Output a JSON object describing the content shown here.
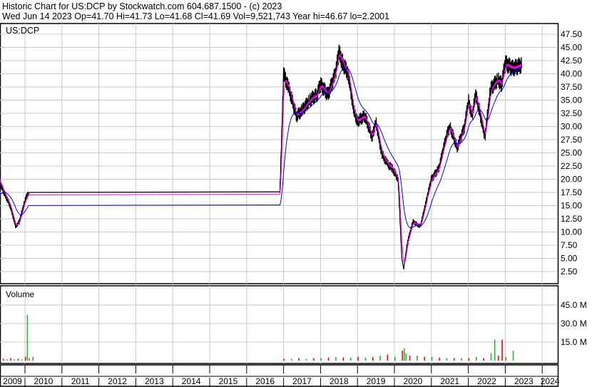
{
  "header": {
    "title": "Historic Chart for US:DCP by Stockwatch.com 604.687.1500 - (c) 2023",
    "quote": "Wed Jun 14 2023   Op=41.70  Hi=41.73  Lo=41.68  Cl=41.69  Vol=9,521,743  Year hi=46.67  lo=2.2001"
  },
  "colors": {
    "price": "#000000",
    "short_ma": "#ff00ff",
    "long_ma": "#0000ff",
    "vol_up": "#33aa33",
    "vol_down": "#ff0000",
    "grid": "#c8c8c8"
  },
  "chart_data": [
    {
      "type": "line",
      "title": "US:DCP",
      "ylim": [
        0,
        50
      ],
      "yticks": [
        "47.50",
        "45.00",
        "42.50",
        "40.00",
        "37.50",
        "35.00",
        "32.50",
        "30.00",
        "27.50",
        "25.00",
        "22.50",
        "20.00",
        "17.50",
        "15.00",
        "12.50",
        "10.00",
        "7.50",
        "5.00",
        "2.50"
      ],
      "series": [
        {
          "name": "price",
          "x": [
            2009.0,
            2009.15,
            2009.3,
            2009.4,
            2009.6,
            2009.75,
            2009.85,
            2010.0,
            2010.1,
            2016.9,
            2017.0,
            2017.15,
            2017.35,
            2017.5,
            2017.7,
            2017.9,
            2018.0,
            2018.2,
            2018.4,
            2018.5,
            2018.6,
            2018.75,
            2018.9,
            2019.0,
            2019.2,
            2019.4,
            2019.5,
            2019.65,
            2019.8,
            2019.95,
            2020.1,
            2020.2,
            2020.25,
            2020.35,
            2020.5,
            2020.7,
            2020.9,
            2021.0,
            2021.2,
            2021.4,
            2021.5,
            2021.7,
            2021.9,
            2022.0,
            2022.1,
            2022.2,
            2022.3,
            2022.45,
            2022.6,
            2022.8,
            2022.9,
            2023.0,
            2023.2,
            2023.45
          ],
          "y": [
            13,
            17,
            20,
            18,
            15,
            11,
            12,
            16,
            17.5,
            17.5,
            40,
            37,
            32,
            33,
            35,
            36,
            38,
            36,
            40,
            44,
            42,
            40,
            33,
            31,
            32,
            28,
            31,
            25,
            23,
            22,
            20,
            5,
            3,
            8,
            12,
            11,
            17,
            20,
            22,
            28,
            30,
            26,
            30,
            35,
            32,
            36,
            33,
            28,
            37,
            39,
            38,
            42,
            41,
            41.7
          ]
        }
      ]
    },
    {
      "type": "bar",
      "title": "Volume",
      "yticks": [
        "45.0 M",
        "30.0 M",
        "15.0 M"
      ],
      "series": [
        {
          "name": "volume_millions",
          "x": [
            2009.0,
            2009.1,
            2009.2,
            2009.3,
            2009.4,
            2009.5,
            2009.6,
            2009.7,
            2009.8,
            2009.9,
            2010.0,
            2010.05,
            2010.1,
            2010.2,
            2017.0,
            2017.2,
            2017.4,
            2017.6,
            2017.8,
            2018.0,
            2018.2,
            2018.4,
            2018.6,
            2018.8,
            2019.0,
            2019.2,
            2019.4,
            2019.6,
            2019.8,
            2020.0,
            2020.2,
            2020.25,
            2020.3,
            2020.4,
            2020.6,
            2020.8,
            2021.0,
            2021.2,
            2021.4,
            2021.6,
            2021.8,
            2022.0,
            2022.2,
            2022.4,
            2022.6,
            2022.7,
            2022.8,
            2022.9,
            2023.0,
            2023.2
          ],
          "y": [
            1,
            1.5,
            6,
            1,
            1.5,
            1,
            2,
            1,
            1.5,
            1,
            3,
            37,
            2,
            3,
            1.5,
            1.5,
            2,
            1.5,
            2,
            2,
            2.5,
            3,
            2.5,
            2.5,
            3,
            2.5,
            3,
            4,
            5,
            3,
            8,
            10,
            6,
            4,
            4,
            3,
            3,
            2.5,
            2,
            2,
            2,
            2,
            3,
            2,
            6,
            17,
            4,
            17,
            3,
            8
          ],
          "up": [
            0,
            1,
            0,
            1,
            0,
            1,
            0,
            1,
            0,
            1,
            0,
            1,
            1,
            1,
            0,
            1,
            0,
            1,
            0,
            1,
            0,
            1,
            0,
            1,
            0,
            1,
            0,
            1,
            0,
            1,
            0,
            1,
            1,
            0,
            1,
            0,
            1,
            0,
            1,
            0,
            1,
            0,
            1,
            0,
            1,
            1,
            0,
            0,
            1,
            1
          ]
        }
      ]
    }
  ],
  "xaxis": {
    "labels": [
      "2009",
      "2010",
      "2011",
      "2012",
      "2013",
      "2014",
      "2015",
      "2016",
      "2017",
      "2018",
      "2019",
      "2020",
      "2021",
      "2022",
      "2023",
      "2024"
    ]
  }
}
